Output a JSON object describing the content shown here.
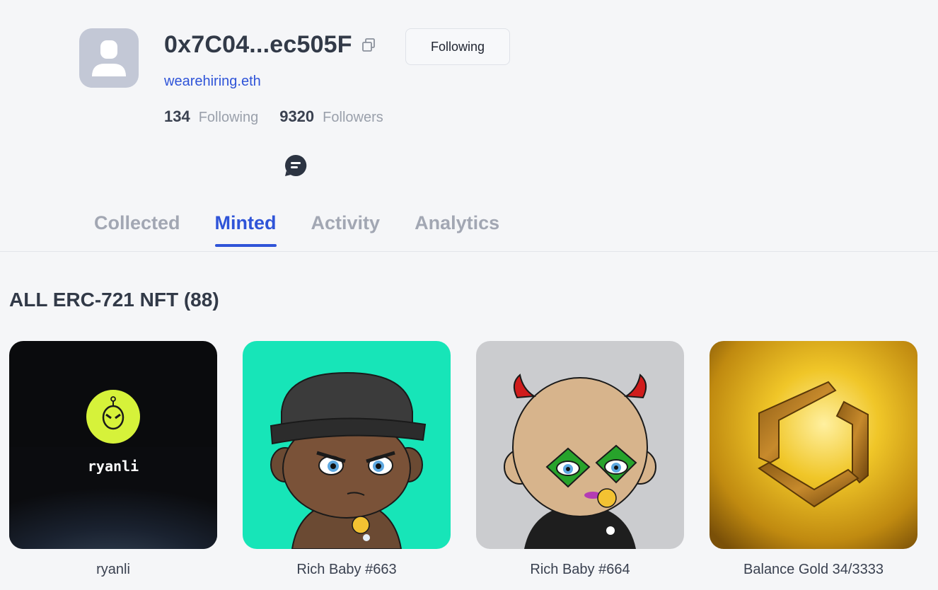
{
  "profile": {
    "address": "0x7C04...ec505F",
    "ens": "wearehiring.eth",
    "follow_button": "Following",
    "following_count": "134",
    "following_label": "Following",
    "followers_count": "9320",
    "followers_label": "Followers"
  },
  "tabs": [
    {
      "label": "Collected",
      "active": false
    },
    {
      "label": "Minted",
      "active": true
    },
    {
      "label": "Activity",
      "active": false
    },
    {
      "label": "Analytics",
      "active": false
    }
  ],
  "section_title": "ALL ERC-721 NFT (88)",
  "nfts": [
    {
      "name": "ryanli",
      "art_text": "ryanli"
    },
    {
      "name": "Rich Baby #663"
    },
    {
      "name": "Rich Baby #664"
    },
    {
      "name": "Balance Gold 34/3333"
    }
  ],
  "colors": {
    "accent": "#2f54d8",
    "mint_bg": "#17e5b8",
    "alien_lime": "#d6f23a"
  },
  "icons": [
    "avatar-placeholder-icon",
    "copy-icon",
    "chat-icon"
  ]
}
